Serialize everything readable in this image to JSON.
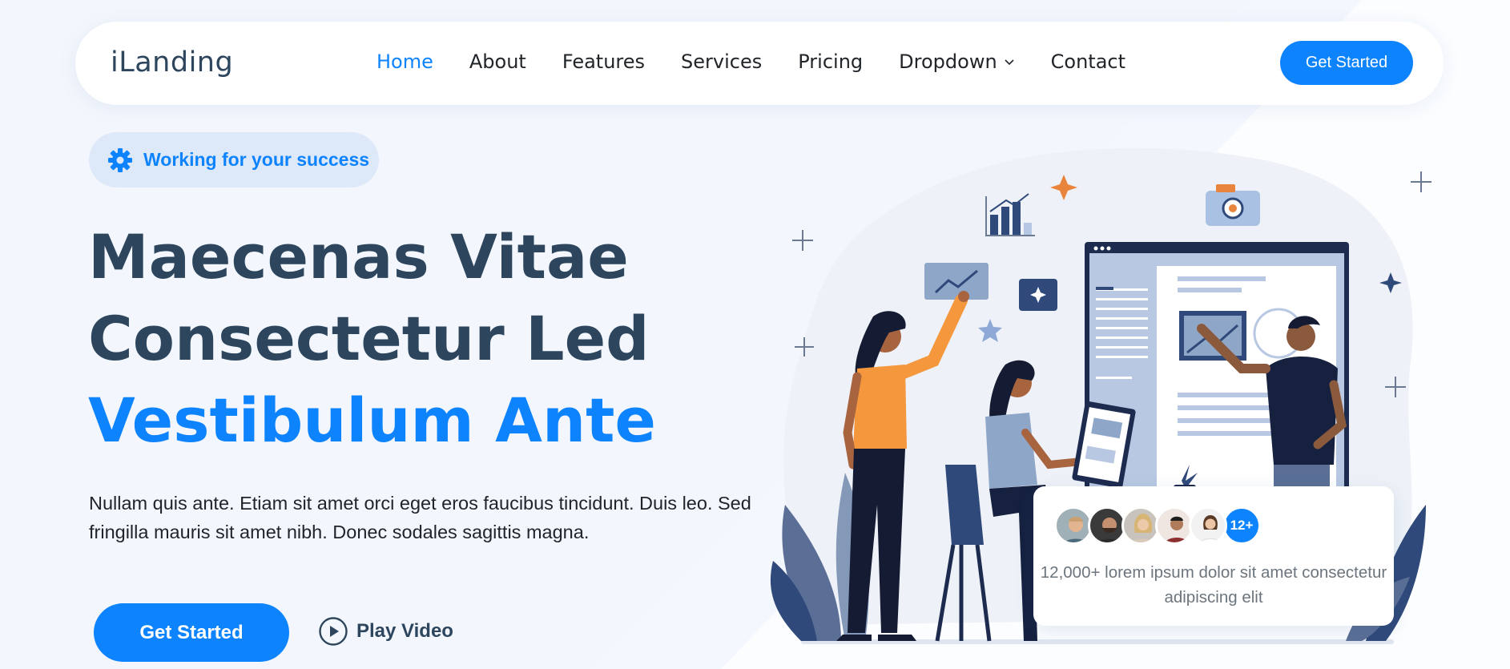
{
  "header": {
    "logo": "iLanding",
    "nav": [
      {
        "label": "Home",
        "active": true
      },
      {
        "label": "About"
      },
      {
        "label": "Features"
      },
      {
        "label": "Services"
      },
      {
        "label": "Pricing"
      },
      {
        "label": "Dropdown",
        "has_dropdown": true
      },
      {
        "label": "Contact"
      }
    ],
    "cta_label": "Get Started"
  },
  "hero": {
    "badge_icon": "gear-icon",
    "badge_text": "Working for your success",
    "title_line1": "Maecenas Vitae",
    "title_line2": "Consectetur Led",
    "title_accent": "Vestibulum Ante",
    "description": "Nullam quis ante. Etiam sit amet orci eget eros faucibus tincidunt. Duis leo. Sed fringilla mauris sit amet nibh. Donec sodales sagittis magna.",
    "primary_button": "Get Started",
    "play_icon": "play-circle-icon",
    "play_label": "Play Video"
  },
  "customers_card": {
    "count_badge": "12+",
    "text": "12,000+ lorem ipsum dolor sit amet consectetur adipiscing elit"
  },
  "colors": {
    "accent": "#0d83fd",
    "heading": "#2d465e",
    "background": "#f3f7fd",
    "badge_bg": "#dde9f9"
  }
}
